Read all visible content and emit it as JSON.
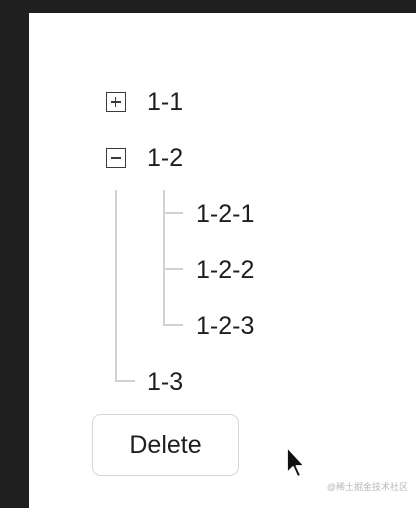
{
  "tree": {
    "nodes": [
      {
        "label": "1-1",
        "expanded": false,
        "toggle_icon": "plus-square-icon"
      },
      {
        "label": "1-2",
        "expanded": true,
        "toggle_icon": "minus-square-icon",
        "children": [
          {
            "label": "1-2-1"
          },
          {
            "label": "1-2-2"
          },
          {
            "label": "1-2-3"
          }
        ]
      },
      {
        "label": "1-3"
      }
    ]
  },
  "actions": {
    "delete_label": "Delete"
  },
  "watermark": "@稀土掘金技术社区",
  "colors": {
    "frame_background": "#1f1f1f",
    "panel_background": "#ffffff",
    "text": "#1e1e1e",
    "tree_line": "#d2d2d2",
    "button_border": "#d6d6d6"
  }
}
